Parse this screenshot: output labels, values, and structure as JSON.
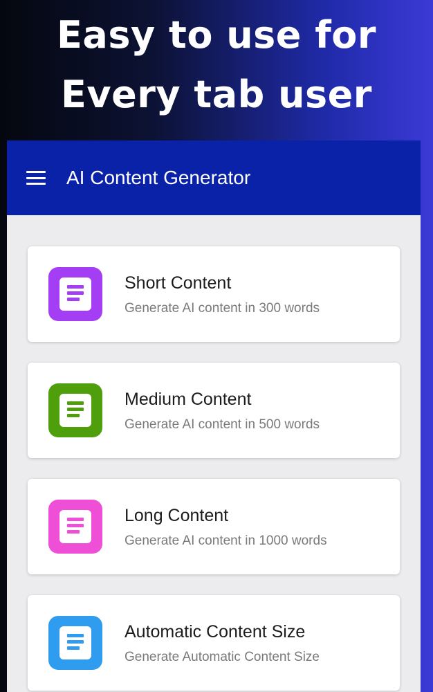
{
  "promo": {
    "line1": "Easy to use for",
    "line2": "Every tab user"
  },
  "app_bar": {
    "title": "AI Content Generator",
    "menu_icon": "hamburger-menu-icon"
  },
  "cards": [
    {
      "title": "Short Content",
      "subtitle": "Generate AI content in 300 words",
      "icon": "document-icon",
      "color": "#a43ef5"
    },
    {
      "title": "Medium Content",
      "subtitle": "Generate AI content in 500 words",
      "icon": "document-icon",
      "color": "#4f9f0d"
    },
    {
      "title": "Long Content",
      "subtitle": "Generate AI content in 1000 words",
      "icon": "document-icon",
      "color": "#ee4fd6"
    },
    {
      "title": "Automatic Content Size",
      "subtitle": "Generate Automatic Content Size",
      "icon": "document-icon",
      "color": "#2f9cf0"
    }
  ]
}
